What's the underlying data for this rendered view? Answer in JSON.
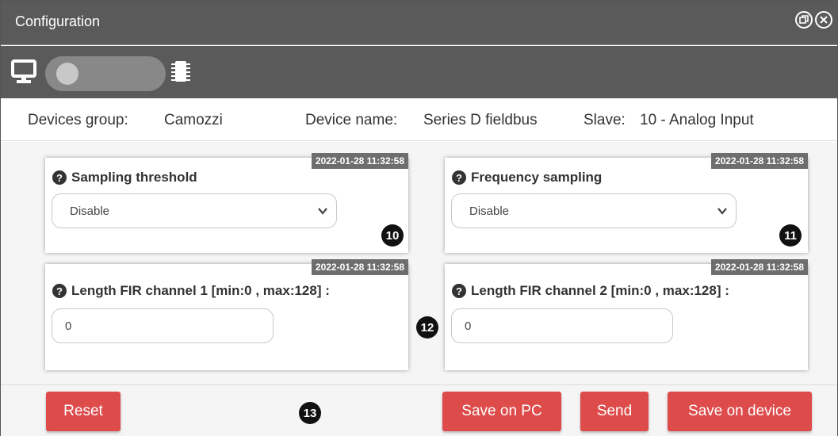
{
  "window": {
    "title": "Configuration",
    "title_icons": [
      "restore-icon",
      "close-icon"
    ]
  },
  "toolbar": {
    "left_icon": "desktop-icon",
    "toggle_state": "off",
    "right_icon": "chip-icon"
  },
  "info": {
    "group_label": "Devices group:",
    "group_value": "Camozzi",
    "device_label": "Device name:",
    "device_value": "Series D fieldbus",
    "slave_label": "Slave:",
    "slave_value": "10 - Analog Input"
  },
  "cards": [
    {
      "timestamp": "2022-01-28 11:32:58",
      "label": "Sampling threshold",
      "control": "select",
      "value": "Disable"
    },
    {
      "timestamp": "2022-01-28 11:32:58",
      "label": "Frequency sampling",
      "control": "select",
      "value": "Disable"
    },
    {
      "timestamp": "2022-01-28 11:32:58",
      "label": "Length FIR channel 1 [min:0 , max:128] :",
      "control": "input",
      "value": "0"
    },
    {
      "timestamp": "2022-01-28 11:32:58",
      "label": "Length FIR channel 2 [min:0 , max:128] :",
      "control": "input",
      "value": "0"
    }
  ],
  "badges": [
    "10",
    "11",
    "12",
    "13"
  ],
  "footer": {
    "reset_label": "Reset",
    "save_pc_label": "Save on PC",
    "send_label": "Send",
    "save_device_label": "Save on device"
  },
  "colors": {
    "titlebar": "#5a5a5a",
    "button": "#dd4b4b",
    "stamp": "#6e6e6e"
  }
}
